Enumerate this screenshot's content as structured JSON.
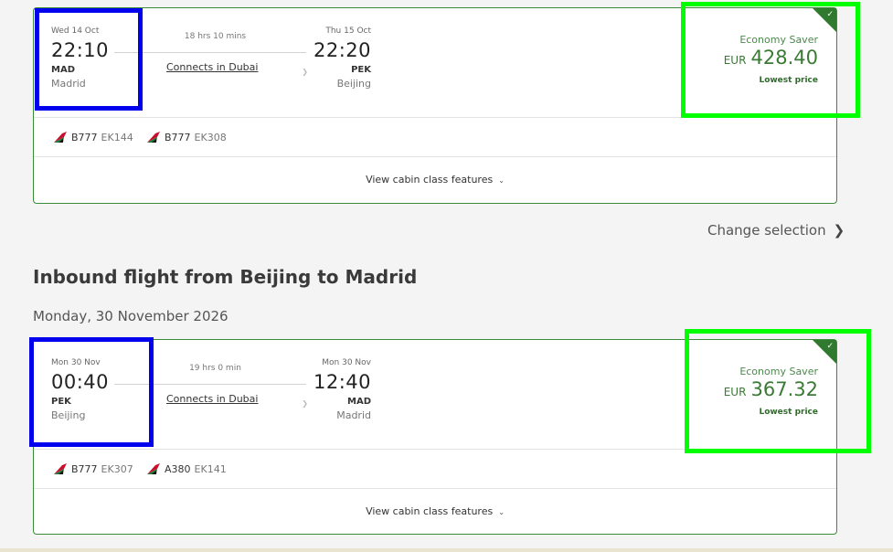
{
  "outbound": {
    "departure": {
      "date": "Wed 14 Oct",
      "time": "22:10",
      "code": "MAD",
      "city": "Madrid"
    },
    "duration": "18 hrs 10 mins",
    "connection": "Connects in Dubai",
    "arrival": {
      "date": "Thu 15 Oct",
      "time": "22:20",
      "code": "PEK",
      "city": "Beijing"
    },
    "fare": {
      "label": "Economy Saver",
      "currency": "EUR",
      "amount": "428.40",
      "badge": "Lowest price"
    },
    "segments": [
      {
        "aircraft": "B777",
        "flight": "EK144"
      },
      {
        "aircraft": "B777",
        "flight": "EK308"
      }
    ],
    "features_label": "View cabin class features"
  },
  "change_selection": "Change selection",
  "inbound_heading": "Inbound flight from Beijing to Madrid",
  "inbound_date": "Monday, 30 November 2026",
  "inbound": {
    "departure": {
      "date": "Mon 30 Nov",
      "time": "00:40",
      "code": "PEK",
      "city": "Beijing"
    },
    "duration": "19 hrs 0 min",
    "connection": "Connects in Dubai",
    "arrival": {
      "date": "Mon 30 Nov",
      "time": "12:40",
      "code": "MAD",
      "city": "Madrid"
    },
    "fare": {
      "label": "Economy Saver",
      "currency": "EUR",
      "amount": "367.32",
      "badge": "Lowest price"
    },
    "segments": [
      {
        "aircraft": "B777",
        "flight": "EK307"
      },
      {
        "aircraft": "A380",
        "flight": "EK141"
      }
    ],
    "features_label": "View cabin class features"
  },
  "icons": {
    "airline_tail": "emirates-tail-icon",
    "selected_check": "check-icon",
    "features_chevron": "chevron-down-icon",
    "change_chevron": "chevron-right-icon"
  },
  "colors": {
    "card_border": "#3a8a3a",
    "price_green": "#3a7a34",
    "highlight_blue": "#0000ee",
    "highlight_green": "#00ff00"
  }
}
